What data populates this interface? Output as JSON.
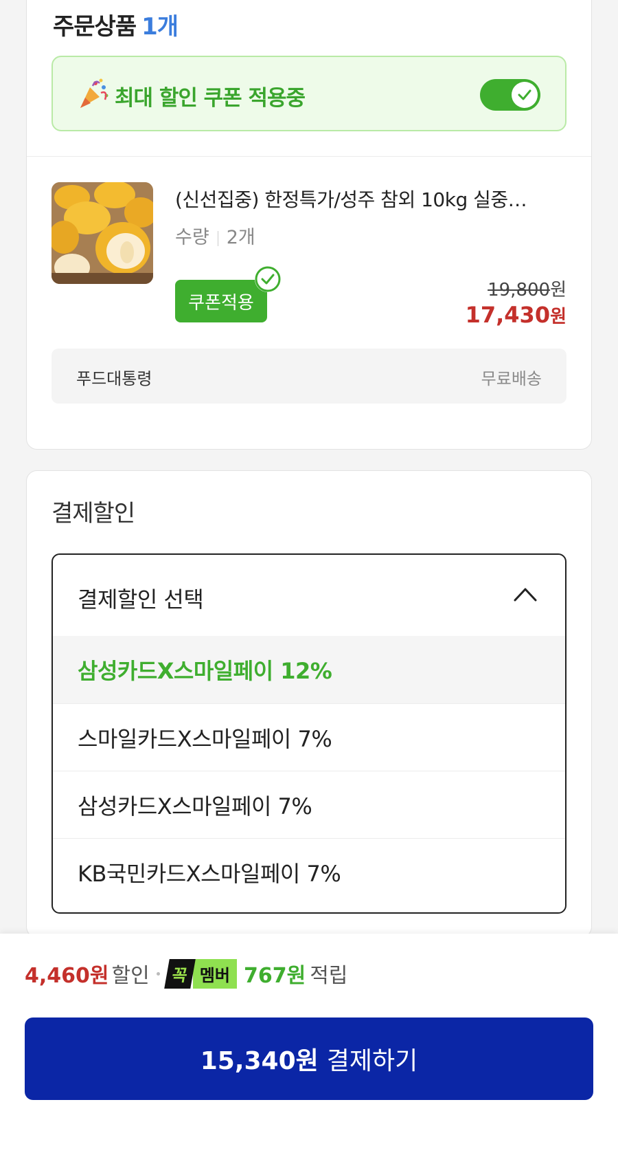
{
  "order_section": {
    "title": "주문상품",
    "count": "1개",
    "coupon_banner": {
      "label": "최대 할인 쿠폰 적용중",
      "toggle_on": true
    },
    "product": {
      "name": "(신선집중) 한정특가/성주 참외 10kg 실중…",
      "qty_label": "수량",
      "qty_value": "2개",
      "coupon_chip": "쿠폰적용",
      "orig_price": "19,800",
      "orig_currency": "원",
      "sale_price": "17,430",
      "sale_currency": "원"
    },
    "seller": {
      "name": "푸드대통령",
      "shipping": "무료배송"
    }
  },
  "payment_discount": {
    "title": "결제할인",
    "dropdown_label": "결제할인 선택",
    "options": [
      "삼성카드X스마일페이 12%",
      "스마일카드X스마일페이 7%",
      "삼성카드X스마일페이 7%",
      "KB국민카드X스마일페이 7%"
    ],
    "selected_index": 0
  },
  "bottom_bar": {
    "discount_amount": "4,460원",
    "discount_label": "할인",
    "badge_part1": "꼭",
    "badge_part2": "멤버",
    "points": "767원",
    "points_label": "적립",
    "pay_amount": "15,340원",
    "pay_label": "결제하기"
  },
  "colors": {
    "accent_green": "#3fae2f",
    "price_red": "#c4302b",
    "pay_blue": "#0b26a6",
    "count_blue": "#3b7ddd"
  }
}
